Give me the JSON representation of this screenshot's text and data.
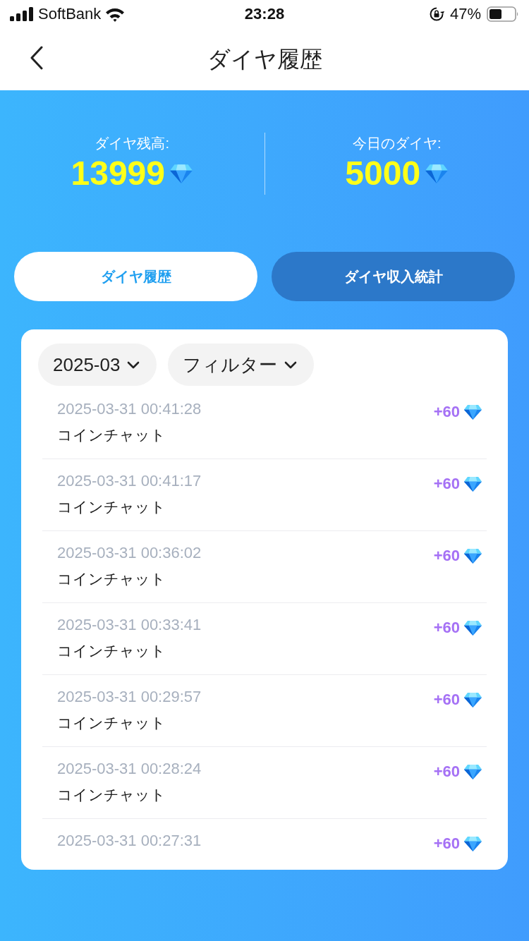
{
  "status_bar": {
    "carrier": "SoftBank",
    "time": "23:28",
    "battery": "47%"
  },
  "nav": {
    "title": "ダイヤ履歴"
  },
  "stats": [
    {
      "label": "ダイヤ残高:",
      "value": "13999"
    },
    {
      "label": "今日のダイヤ:",
      "value": "5000"
    }
  ],
  "tabs": [
    {
      "label": "ダイヤ履歴",
      "selected": true
    },
    {
      "label": "ダイヤ収入統計",
      "selected": false
    }
  ],
  "filters": [
    {
      "label": "2025-03"
    },
    {
      "label": "フィルター"
    }
  ],
  "records": [
    {
      "time": "2025-03-31 00:41:28",
      "label": "コインチャット",
      "amount": "+60"
    },
    {
      "time": "2025-03-31 00:41:17",
      "label": "コインチャット",
      "amount": "+60"
    },
    {
      "time": "2025-03-31 00:36:02",
      "label": "コインチャット",
      "amount": "+60"
    },
    {
      "time": "2025-03-31 00:33:41",
      "label": "コインチャット",
      "amount": "+60"
    },
    {
      "time": "2025-03-31 00:29:57",
      "label": "コインチャット",
      "amount": "+60"
    },
    {
      "time": "2025-03-31 00:28:24",
      "label": "コインチャット",
      "amount": "+60"
    },
    {
      "time": "2025-03-31 00:27:31",
      "amount": "+60"
    }
  ]
}
